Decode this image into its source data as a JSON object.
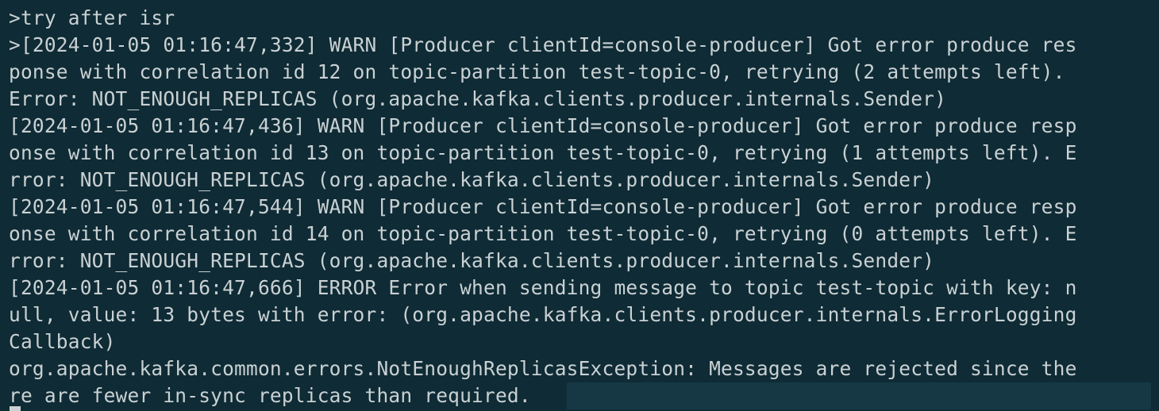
{
  "terminal": {
    "lines": [
      ">try after isr",
      ">[2024-01-05 01:16:47,332] WARN [Producer clientId=console-producer] Got error produce res",
      "ponse with correlation id 12 on topic-partition test-topic-0, retrying (2 attempts left).",
      "Error: NOT_ENOUGH_REPLICAS (org.apache.kafka.clients.producer.internals.Sender)",
      "[2024-01-05 01:16:47,436] WARN [Producer clientId=console-producer] Got error produce resp",
      "onse with correlation id 13 on topic-partition test-topic-0, retrying (1 attempts left). E",
      "rror: NOT_ENOUGH_REPLICAS (org.apache.kafka.clients.producer.internals.Sender)",
      "[2024-01-05 01:16:47,544] WARN [Producer clientId=console-producer] Got error produce resp",
      "onse with correlation id 14 on topic-partition test-topic-0, retrying (0 attempts left). E",
      "rror: NOT_ENOUGH_REPLICAS (org.apache.kafka.clients.producer.internals.Sender)",
      "[2024-01-05 01:16:47,666] ERROR Error when sending message to topic test-topic with key: n",
      "ull, value: 13 bytes with error: (org.apache.kafka.clients.producer.internals.ErrorLogging",
      "Callback)",
      "org.apache.kafka.common.errors.NotEnoughReplicasException: Messages are rejected since the",
      "re are fewer in-sync replicas than required."
    ]
  },
  "colors": {
    "background": "#0f2b35",
    "text": "#c9d1d3",
    "current_line_highlight": "#163845"
  }
}
